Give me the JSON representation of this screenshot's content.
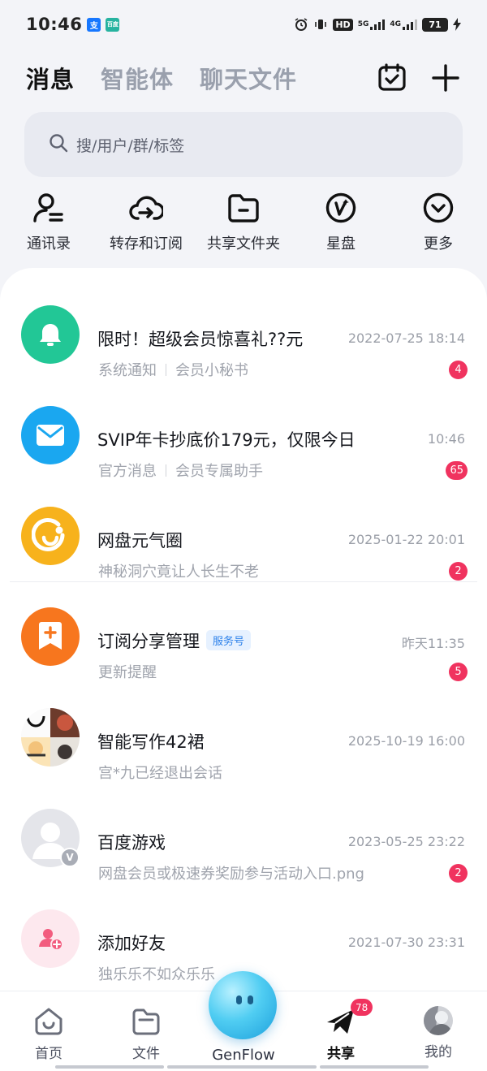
{
  "status_bar": {
    "time": "10:46",
    "app1": "支",
    "app2": "百度",
    "hd": "HD",
    "net1": "5G",
    "net2": "4G",
    "battery": "71"
  },
  "header": {
    "tabs": [
      "消息",
      "智能体",
      "聊天文件"
    ]
  },
  "search": {
    "placeholder": "搜/用户/群/标签"
  },
  "quick_actions": [
    {
      "label": "通讯录",
      "icon": "contacts-icon"
    },
    {
      "label": "转存和订阅",
      "icon": "cloud-transfer-icon"
    },
    {
      "label": "共享文件夹",
      "icon": "shared-folder-icon"
    },
    {
      "label": "星盘",
      "icon": "star-disk-icon"
    },
    {
      "label": "更多",
      "icon": "chevron-down-circle-icon"
    }
  ],
  "messages": [
    {
      "title": "限时！超级会员惊喜礼??元",
      "time": "2022-07-25 18:14",
      "sub1": "系统通知",
      "sub2": "会员小秘书",
      "badge": "4",
      "avatar_color": "#22c796",
      "icon": "bell-icon"
    },
    {
      "title": "SVIP年卡抄底价179元，仅限今日",
      "time": "10:46",
      "sub1": "官方消息",
      "sub2": "会员专属助手",
      "badge": "65",
      "avatar_color": "#1aa7f0",
      "icon": "mail-icon"
    },
    {
      "title": "网盘元气圈",
      "time": "2025-01-22 20:01",
      "sub1": "神秘洞穴竟让人长生不老",
      "badge": "2",
      "avatar_color": "#f7b21c",
      "icon": "smile-circle-icon"
    },
    {
      "title": "订阅分享管理",
      "tag": "服务号",
      "time": "昨天11:35",
      "sub1": "更新提醒",
      "badge": "5",
      "avatar_color": "#f7761e",
      "icon": "bookmark-plus-icon"
    },
    {
      "title": "智能写作42裙",
      "time": "2025-10-19 16:00",
      "sub1": "宫*九已经退出会话",
      "avatar_color": "#e9e9ee",
      "icon": "group-avatar-icon"
    },
    {
      "title": "百度游戏",
      "time": "2023-05-25 23:22",
      "sub1": "网盘会员或极速券奖励参与活动入口.png",
      "badge": "2",
      "avatar_color": "#e4e5ea",
      "icon": "default-user-icon"
    },
    {
      "title": "添加好友",
      "time": "2021-07-30 23:31",
      "sub1": "独乐乐不如众乐乐",
      "avatar_color": "#fde8ee",
      "icon": "add-friend-icon"
    }
  ],
  "bottom_nav": [
    {
      "label": "首页",
      "icon": "home-icon"
    },
    {
      "label": "文件",
      "icon": "folder-icon"
    },
    {
      "label": "GenFlow",
      "icon": "genflow-orb-icon"
    },
    {
      "label": "共享",
      "icon": "paper-plane-icon",
      "badge": "78",
      "active": true
    },
    {
      "label": "我的",
      "icon": "profile-avatar-icon"
    }
  ]
}
